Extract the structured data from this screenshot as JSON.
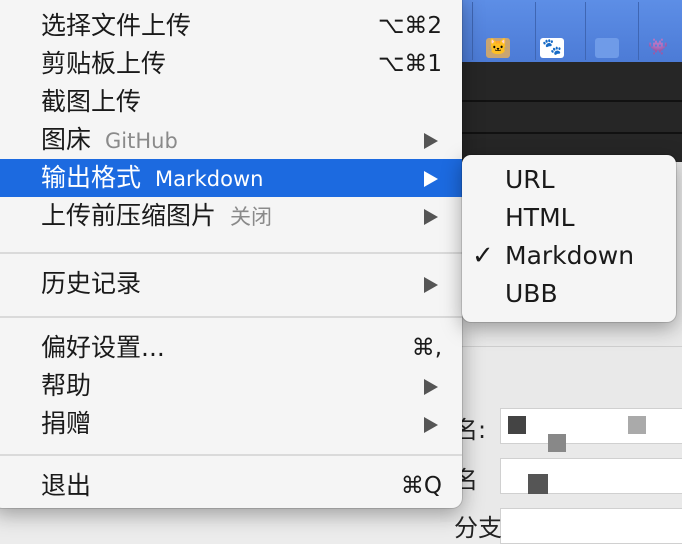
{
  "main_menu": {
    "items": [
      {
        "label": "选择文件上传",
        "shortcut": "⌥⌘2"
      },
      {
        "label": "剪贴板上传",
        "shortcut": "⌥⌘1"
      },
      {
        "label": "截图上传"
      },
      {
        "label": "图床",
        "sublabel": "GitHub"
      },
      {
        "label": "输出格式",
        "sublabel": "Markdown"
      },
      {
        "label": "上传前压缩图片",
        "sublabel": "关闭"
      },
      {
        "label": "历史记录"
      },
      {
        "label": "偏好设置...",
        "shortcut": "⌘,"
      },
      {
        "label": "帮助"
      },
      {
        "label": "捐赠"
      },
      {
        "label": "退出",
        "shortcut": "⌘Q"
      }
    ],
    "highlighted_index": 4,
    "highlight_color": "#1c6ae0"
  },
  "output_format_submenu": {
    "items": [
      {
        "label": "URL",
        "checked": false
      },
      {
        "label": "HTML",
        "checked": false
      },
      {
        "label": "Markdown",
        "checked": true
      },
      {
        "label": "UBB",
        "checked": false
      }
    ],
    "check_glyph": "✓"
  },
  "background_app": {
    "label_1": "名:",
    "label_2": "名",
    "label_3": "分支"
  }
}
